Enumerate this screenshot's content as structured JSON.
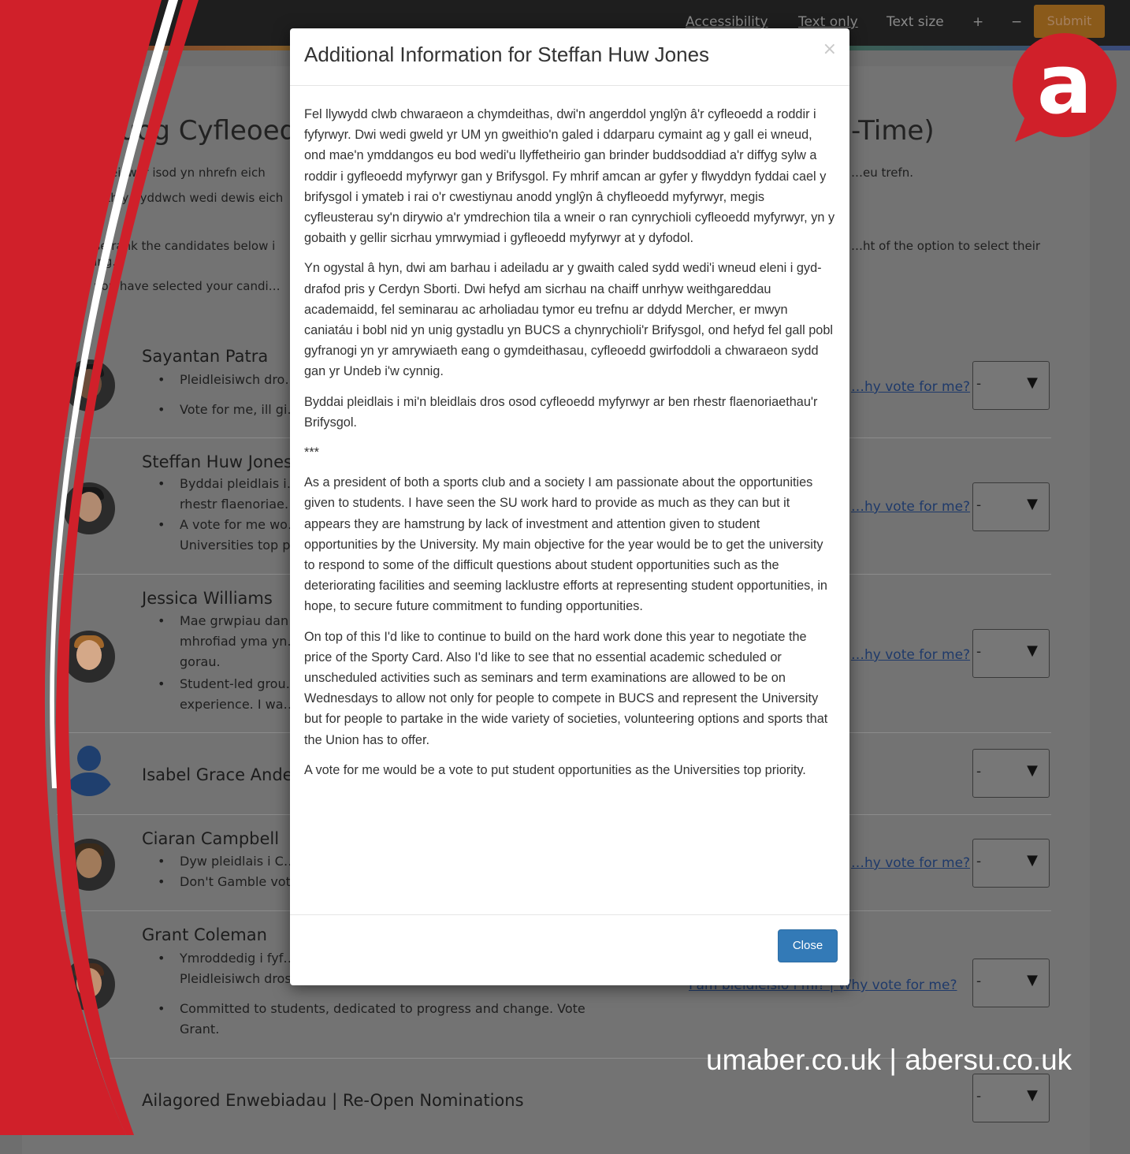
{
  "topnav": {
    "accessibility": "Accessibility",
    "text_only": "Text only",
    "text_size": "Text size",
    "plus": "+",
    "minus": "−",
    "submit": "Submit"
  },
  "page": {
    "title_left": "…uog Cyfleoedd",
    "title_right": "-Time)",
    "intro_welsh_1": "…ngeiswyr isod yn nhrefn eich",
    "intro_welsh_1_right": "…eu trefn.",
    "intro_welsh_2": "…aith y byddwch wedi dewis eich",
    "intro_en_1": "…ease rank the candidates below i",
    "intro_en_1_right": "…ht of the option to select their",
    "intro_en_2": "…nking.",
    "intro_en_3": "Once you have selected your candi…"
  },
  "candidates": [
    {
      "name": "Sayantan Patra",
      "bullets": [
        "Pleidleisiwch dro…",
        "Vote for me, ill gi…"
      ],
      "why": "…hy vote for me?",
      "select": "-"
    },
    {
      "name": "Steffan Huw Jones",
      "bullets": [
        "Byddai pleidlais i…",
        "rhestr flaenoriae…",
        "A vote for me wo…",
        "Universities top p…"
      ],
      "why": "…hy vote for me?",
      "select": "-"
    },
    {
      "name": "Jessica Williams",
      "bullets": [
        "Mae grwpiau dan…",
        "mhrofiad yma yn…",
        "gorau.",
        "Student-led grou…",
        "experience.  I wa…"
      ],
      "why": "…hy vote for me?",
      "select": "-"
    },
    {
      "name": "Isabel Grace Ander…",
      "bullets": [],
      "why": "",
      "select": "-"
    },
    {
      "name": "Ciaran Campbell",
      "bullets": [
        "Dyw pleidlais i C…",
        "Don't Gamble vot…"
      ],
      "why": "…hy vote for me?",
      "select": "-"
    },
    {
      "name": "Grant Coleman",
      "bullets": [
        "Ymroddedig i fyf…",
        "Pleidleisiwch dros Grant.",
        "Committed to students, dedicated to progress and change. Vote",
        "Grant."
      ],
      "why": "Pam bleidleisio i mi? | Why vote for me?",
      "select": "-"
    },
    {
      "name": "Ailagored Enwebiadau | Re-Open Nominations",
      "bullets": [],
      "why": "",
      "select": "-"
    }
  ],
  "modal": {
    "title": "Additional Information for Steffan Huw Jones",
    "close_x": "×",
    "paragraphs": [
      "Fel llywydd clwb chwaraeon a chymdeithas, dwi'n angerddol ynglŷn â'r cyfleoedd a roddir i fyfyrwyr. Dwi wedi gweld yr UM yn gweithio'n galed i ddarparu cymaint ag y gall ei wneud, ond mae'n ymddangos eu bod wedi'u llyffetheirio gan brinder buddsoddiad a'r diffyg sylw a roddir i gyfleoedd myfyrwyr gan y Brifysgol. Fy mhrif amcan ar gyfer y flwyddyn fyddai cael y brifysgol i ymateb i rai o'r cwestiynau anodd ynglŷn â chyfleoedd myfyrwyr, megis cyfleusterau sy'n dirywio a'r ymdrechion tila a wneir o ran cynrychioli cyfleoedd myfyrwyr, yn y gobaith y gellir sicrhau ymrwymiad i gyfleoedd myfyrwyr at y dyfodol.",
      "Yn ogystal â hyn, dwi am barhau i adeiladu ar y gwaith caled sydd wedi'i wneud eleni i gyd-drafod pris y Cerdyn Sborti. Dwi hefyd am sicrhau na chaiff unrhyw weithgareddau academaidd, fel seminarau ac arholiadau tymor eu trefnu ar ddydd Mercher, er mwyn caniatáu i bobl nid yn unig gystadlu yn BUCS a chynrychioli'r Brifysgol, ond hefyd fel gall pobl gyfranogi yn yr amrywiaeth eang o gymdeithasau, cyfleoedd gwirfoddoli a chwaraeon sydd gan yr Undeb i'w cynnig.",
      "Byddai pleidlais i mi'n bleidlais dros osod cyfleoedd myfyrwyr ar ben rhestr flaenoriaethau'r Brifysgol.",
      "***",
      "As a president of both a sports club and a society I am passionate about the opportunities given to students. I have seen the SU work hard to provide as much as they can but it appears they are hamstrung by lack of investment and attention given to student opportunities by the University. My main objective for the year would be to get the university to respond to some of the difficult questions about student opportunities such as the deteriorating facilities and seeming lacklustre efforts at representing student opportunities, in hope, to secure future commitment to funding opportunities.",
      "On top of this I'd like to continue to build on the hard work done this year to negotiate the price of the Sporty Card. Also I'd like to see that no essential academic scheduled or unscheduled activities such as seminars and term examinations are allowed to be on Wednesdays to allow not only for people to compete in BUCS and represent the University but for people to partake in the wide variety of societies, volunteering options and sports that the Union has to offer.",
      "A vote for me would be a vote to put student opportunities as the Universities top priority."
    ],
    "close_button": "Close"
  },
  "branding": {
    "logo_letter": "a",
    "footer_url": "umaber.co.uk | abersu.co.uk",
    "brand_red": "#d0202a"
  }
}
